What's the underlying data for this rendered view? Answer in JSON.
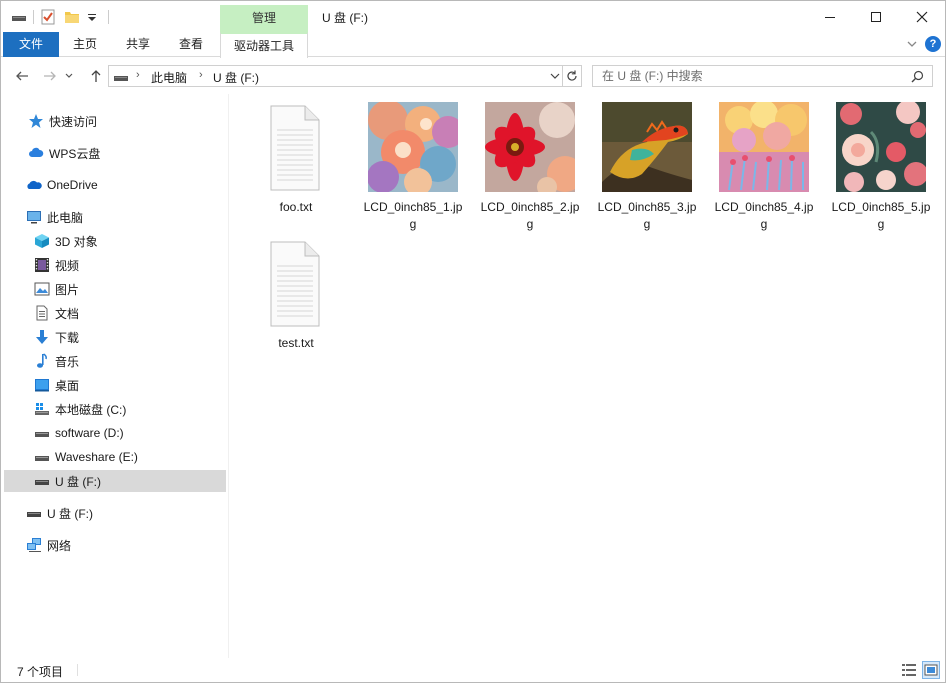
{
  "window": {
    "title": "U 盘 (F:)",
    "context_group": "管理",
    "minimize": "—",
    "maximize": "☐",
    "close": "✕"
  },
  "ribbon": {
    "tabs": [
      "文件",
      "主页",
      "共享",
      "查看",
      "驱动器工具"
    ],
    "file_tab_color": "#1d6fc0",
    "context_color": "#c6efc2"
  },
  "address": {
    "crumbs": [
      "此电脑",
      "U 盘 (F:)"
    ],
    "search_placeholder": "在 U 盘 (F:) 中搜索"
  },
  "sidebar": {
    "items": [
      {
        "label": "快速访问",
        "icon": "star-icon"
      },
      {
        "label": "WPS云盘",
        "icon": "cloud-icon"
      },
      {
        "label": "OneDrive",
        "icon": "onedrive-icon"
      },
      {
        "label": "此电脑",
        "icon": "computer-icon"
      },
      {
        "label": "3D 对象",
        "icon": "cube-icon"
      },
      {
        "label": "视频",
        "icon": "video-icon"
      },
      {
        "label": "图片",
        "icon": "picture-icon"
      },
      {
        "label": "文档",
        "icon": "document-icon"
      },
      {
        "label": "下载",
        "icon": "download-icon"
      },
      {
        "label": "音乐",
        "icon": "music-icon"
      },
      {
        "label": "桌面",
        "icon": "desktop-icon"
      },
      {
        "label": "本地磁盘 (C:)",
        "icon": "windows-drive-icon"
      },
      {
        "label": "software (D:)",
        "icon": "drive-icon"
      },
      {
        "label": "Waveshare (E:)",
        "icon": "drive-icon"
      },
      {
        "label": "U 盘 (F:)",
        "icon": "usb-drive-icon",
        "selected": true
      },
      {
        "label": "U 盘 (F:)",
        "icon": "usb-drive-icon"
      },
      {
        "label": "网络",
        "icon": "network-icon"
      }
    ]
  },
  "files": [
    {
      "name": "foo.txt",
      "type": "text",
      "icon": "text-file-icon"
    },
    {
      "name": "LCD_0inch85_1.jpg",
      "type": "image",
      "icon": "flower-collage-thumbnail"
    },
    {
      "name": "LCD_0inch85_2.jpg",
      "type": "image",
      "icon": "red-gerbera-thumbnail"
    },
    {
      "name": "LCD_0inch85_3.jpg",
      "type": "image",
      "icon": "lizard-thumbnail"
    },
    {
      "name": "LCD_0inch85_4.jpg",
      "type": "image",
      "icon": "dreamy-landscape-thumbnail"
    },
    {
      "name": "LCD_0inch85_5.jpg",
      "type": "image",
      "icon": "roses-thumbnail"
    },
    {
      "name": "test.txt",
      "type": "text",
      "icon": "text-file-icon"
    }
  ],
  "status": {
    "count": "7 个项目"
  }
}
